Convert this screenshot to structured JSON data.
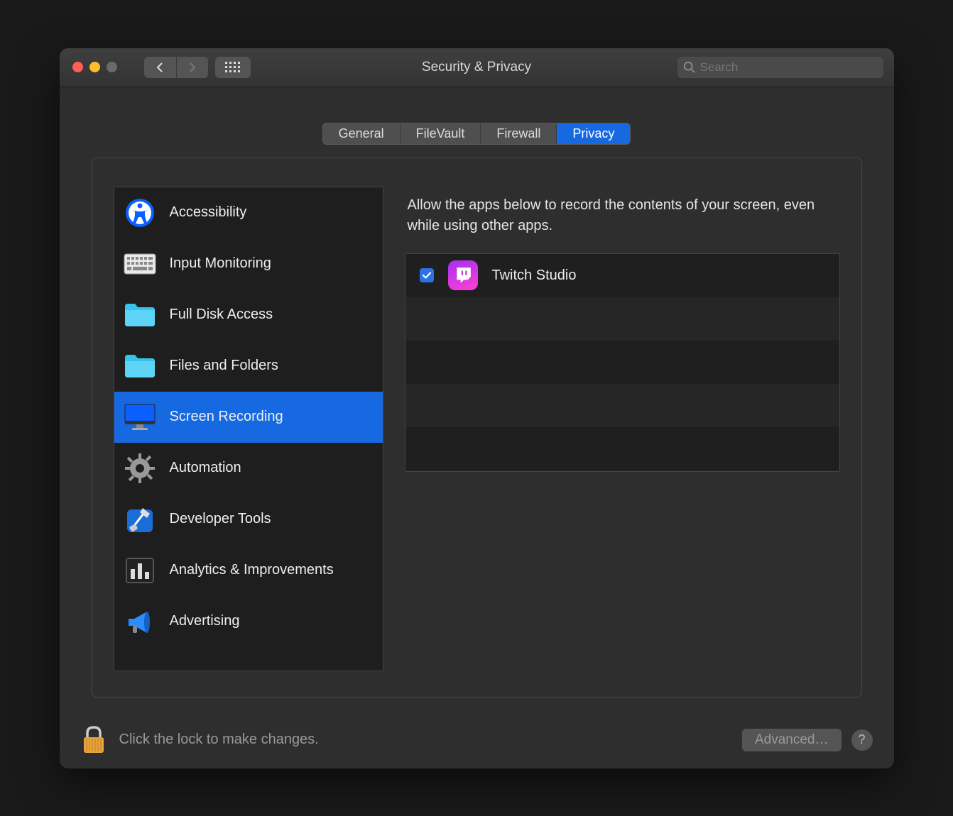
{
  "window": {
    "title": "Security & Privacy"
  },
  "search": {
    "placeholder": "Search"
  },
  "tabs": [
    {
      "label": "General",
      "active": false
    },
    {
      "label": "FileVault",
      "active": false
    },
    {
      "label": "Firewall",
      "active": false
    },
    {
      "label": "Privacy",
      "active": true
    }
  ],
  "sidebar": {
    "items": [
      {
        "label": "Accessibility",
        "icon": "accessibility-icon",
        "selected": false
      },
      {
        "label": "Input Monitoring",
        "icon": "keyboard-icon",
        "selected": false
      },
      {
        "label": "Full Disk Access",
        "icon": "folder-icon",
        "selected": false
      },
      {
        "label": "Files and Folders",
        "icon": "folder-icon",
        "selected": false
      },
      {
        "label": "Screen Recording",
        "icon": "display-icon",
        "selected": true
      },
      {
        "label": "Automation",
        "icon": "gear-icon",
        "selected": false
      },
      {
        "label": "Developer Tools",
        "icon": "hammer-icon",
        "selected": false
      },
      {
        "label": "Analytics & Improvements",
        "icon": "chart-icon",
        "selected": false
      },
      {
        "label": "Advertising",
        "icon": "megaphone-icon",
        "selected": false
      }
    ]
  },
  "main": {
    "description": "Allow the apps below to record the contents of your screen, even while using other apps.",
    "apps": [
      {
        "name": "Twitch Studio",
        "checked": true,
        "icon": "twitch-icon"
      }
    ]
  },
  "footer": {
    "lock_text": "Click the lock to make changes.",
    "advanced_label": "Advanced…",
    "help_label": "?"
  }
}
